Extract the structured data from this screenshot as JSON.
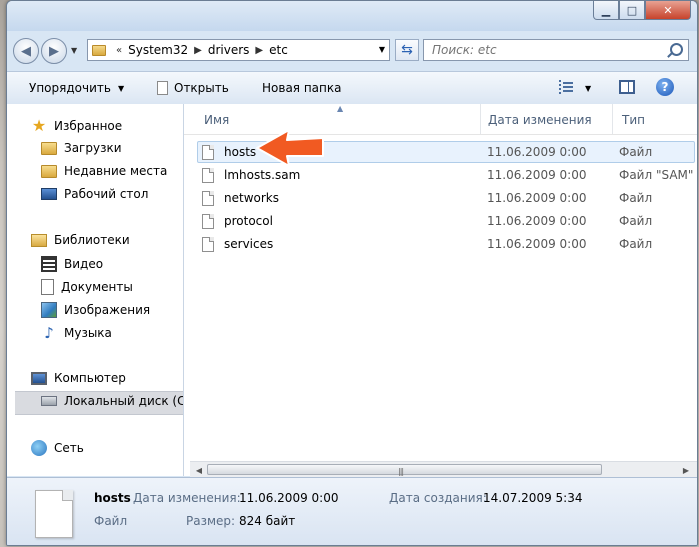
{
  "navigation": {
    "breadcrumb": [
      "System32",
      "drivers",
      "etc"
    ],
    "search_placeholder": "Поиск: etc"
  },
  "toolbar": {
    "organize_label": "Упорядочить",
    "open_label": "Открыть",
    "new_folder_label": "Новая папка"
  },
  "sidebar": {
    "favorites": {
      "label": "Избранное",
      "items": [
        "Загрузки",
        "Недавние места",
        "Рабочий стол"
      ]
    },
    "libraries": {
      "label": "Библиотеки",
      "items": [
        "Видео",
        "Документы",
        "Изображения",
        "Музыка"
      ]
    },
    "computer": {
      "label": "Компьютер",
      "items": [
        "Локальный диск (C"
      ]
    },
    "network": {
      "label": "Сеть"
    }
  },
  "file_list": {
    "columns": [
      "Имя",
      "Дата изменения",
      "Тип"
    ],
    "rows": [
      {
        "name": "hosts",
        "date": "11.06.2009 0:00",
        "type": "Файл"
      },
      {
        "name": "lmhosts.sam",
        "date": "11.06.2009 0:00",
        "type": "Файл \"SAM\""
      },
      {
        "name": "networks",
        "date": "11.06.2009 0:00",
        "type": "Файл"
      },
      {
        "name": "protocol",
        "date": "11.06.2009 0:00",
        "type": "Файл"
      },
      {
        "name": "services",
        "date": "11.06.2009 0:00",
        "type": "Файл"
      }
    ],
    "selected_row": 0
  },
  "details_pane": {
    "file_name": "hosts",
    "file_type": "Файл",
    "modified_label": "Дата изменения:",
    "modified_value": "11.06.2009 0:00",
    "created_label": "Дата создания:",
    "created_value": "14.07.2009 5:34",
    "size_label": "Размер:",
    "size_value": "824 байт"
  },
  "colors": {
    "annotation_arrow": "#f15a22",
    "selection": "#e8f2fd"
  }
}
